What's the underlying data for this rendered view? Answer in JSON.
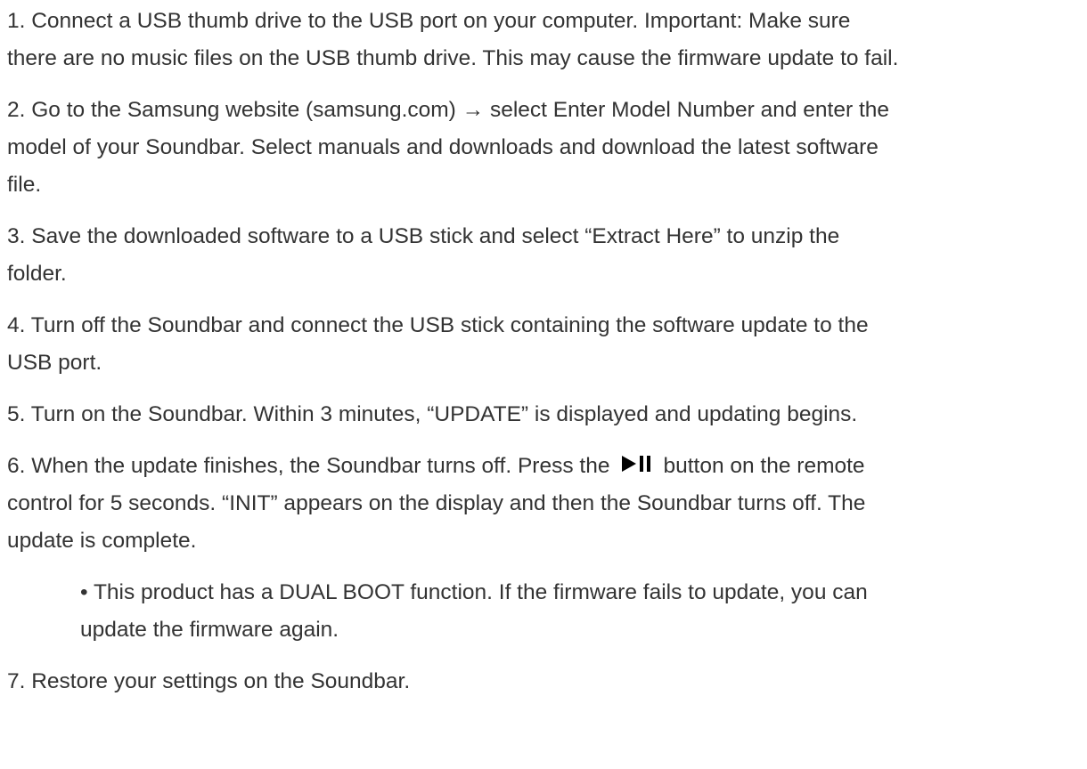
{
  "steps": [
    {
      "lines": [
        "1. Connect a USB thumb drive to the USB port on your computer. Important: Make sure",
        "there are no music files on the USB thumb drive. This may cause the firmware update to fail."
      ]
    },
    {
      "lines": [
        "2. Go to the Samsung website (samsung.com) → select Enter Model Number and enter the",
        "model of your Soundbar. Select manuals and downloads and download the latest software",
        "file."
      ]
    },
    {
      "lines": [
        "3. Save the downloaded software to a USB stick and select “Extract Here” to unzip the",
        "folder."
      ]
    },
    {
      "lines": [
        "4. Turn off the Soundbar and connect the USB stick containing the software update to the",
        "USB port."
      ]
    },
    {
      "lines": [
        "5. Turn on the Soundbar. Within 3 minutes, “UPDATE” is displayed and updating begins."
      ]
    },
    {
      "line1_before_icon": "6. When the update finishes, the Soundbar turns off. Press the",
      "line1_after_icon": "button on the remote",
      "line2": "control for 5 seconds. “INIT” appears on the display and then the Soundbar turns off. The",
      "line3": "update is complete.",
      "icon": "play-pause-icon"
    },
    {
      "lines": [
        "• This product has a DUAL BOOT function. If the firmware fails to update, you can",
        "update the firmware again."
      ]
    },
    {
      "lines": [
        "7. Restore your settings on the Soundbar."
      ]
    }
  ],
  "colors": {
    "text": "#333333",
    "icon": "#000000",
    "background": "#ffffff"
  }
}
